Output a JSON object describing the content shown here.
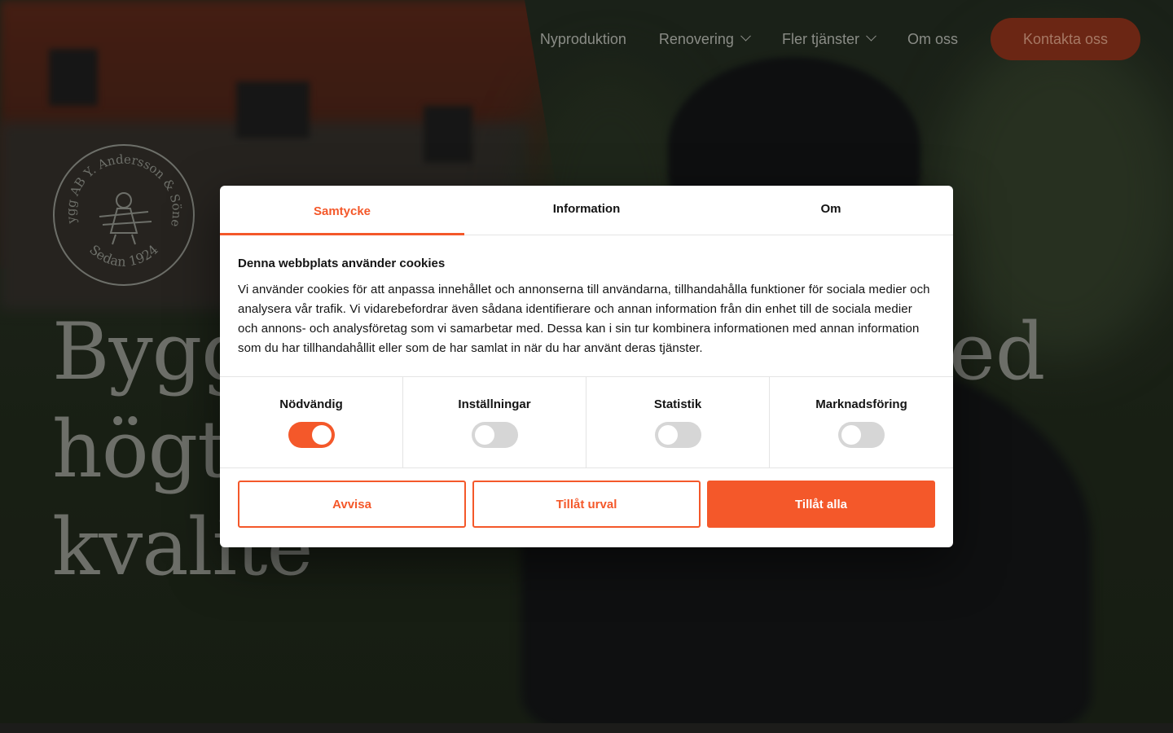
{
  "nav": {
    "items": [
      {
        "label": "Nyproduktion",
        "has_dropdown": false
      },
      {
        "label": "Renovering",
        "has_dropdown": true
      },
      {
        "label": "Fler tjänster",
        "has_dropdown": true
      },
      {
        "label": "Om oss",
        "has_dropdown": false
      }
    ],
    "cta_label": "Kontakta oss"
  },
  "logo": {
    "text_top": "Bygg AB Y. Andersson & Söner",
    "text_bottom": "Sedan 1924"
  },
  "hero": {
    "headline_lines": [
      "Bygg",
      "högt",
      "kvalite"
    ],
    "headline_right_fragment": "ed"
  },
  "cookie_dialog": {
    "tabs": [
      {
        "label": "Samtycke",
        "active": true
      },
      {
        "label": "Information",
        "active": false
      },
      {
        "label": "Om",
        "active": false
      }
    ],
    "title": "Denna webbplats använder cookies",
    "body": "Vi använder cookies för att anpassa innehållet och annonserna till användarna, tillhandahålla funktioner för sociala medier och analysera vår trafik. Vi vidarebefordrar även sådana identifierare och annan information från din enhet till de sociala medier och annons- och analysföretag som vi samarbetar med. Dessa kan i sin tur kombinera informationen med annan information som du har tillhandahållit eller som de har samlat in när du har använt deras tjänster.",
    "categories": [
      {
        "label": "Nödvändig",
        "enabled": true
      },
      {
        "label": "Inställningar",
        "enabled": false
      },
      {
        "label": "Statistik",
        "enabled": false
      },
      {
        "label": "Marknadsföring",
        "enabled": false
      }
    ],
    "buttons": {
      "reject": "Avvisa",
      "allow_selection": "Tillåt urval",
      "allow_all": "Tillåt alla"
    }
  },
  "colors": {
    "accent": "#f4582a",
    "cta_dim": "#6b2614"
  }
}
